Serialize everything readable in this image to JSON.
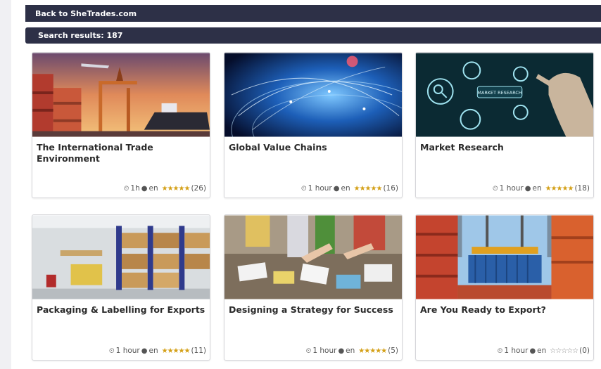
{
  "topbar": {
    "back_link": "Back to SheTrades.com"
  },
  "results": {
    "label": "Search results: 187"
  },
  "icons": {
    "clock": "clock-icon",
    "globe": "globe-icon",
    "star": "star-icon"
  },
  "colors": {
    "bar": "#2d3047",
    "star": "#d4a017"
  },
  "courses": [
    {
      "title": "The International Trade Environment",
      "duration": "1h",
      "lang": "en",
      "rating_count": "(26)",
      "stars": "★★★★★"
    },
    {
      "title": "Global Value Chains",
      "duration": "1 hour",
      "lang": "en",
      "rating_count": "(16)",
      "stars": "★★★★★"
    },
    {
      "title": "Market Research",
      "duration": "1 hour",
      "lang": "en",
      "rating_count": "(18)",
      "stars": "★★★★★"
    },
    {
      "title": "Packaging & Labelling for Exports",
      "duration": "1 hour",
      "lang": "en",
      "rating_count": "(11)",
      "stars": "★★★★★"
    },
    {
      "title": "Designing a Strategy for Success",
      "duration": "1 hour",
      "lang": "en",
      "rating_count": "(5)",
      "stars": "★★★★★"
    },
    {
      "title": "Are You Ready to Export?",
      "duration": "1 hour",
      "lang": "en",
      "rating_count": "(0)",
      "stars": "☆☆☆☆☆"
    }
  ]
}
